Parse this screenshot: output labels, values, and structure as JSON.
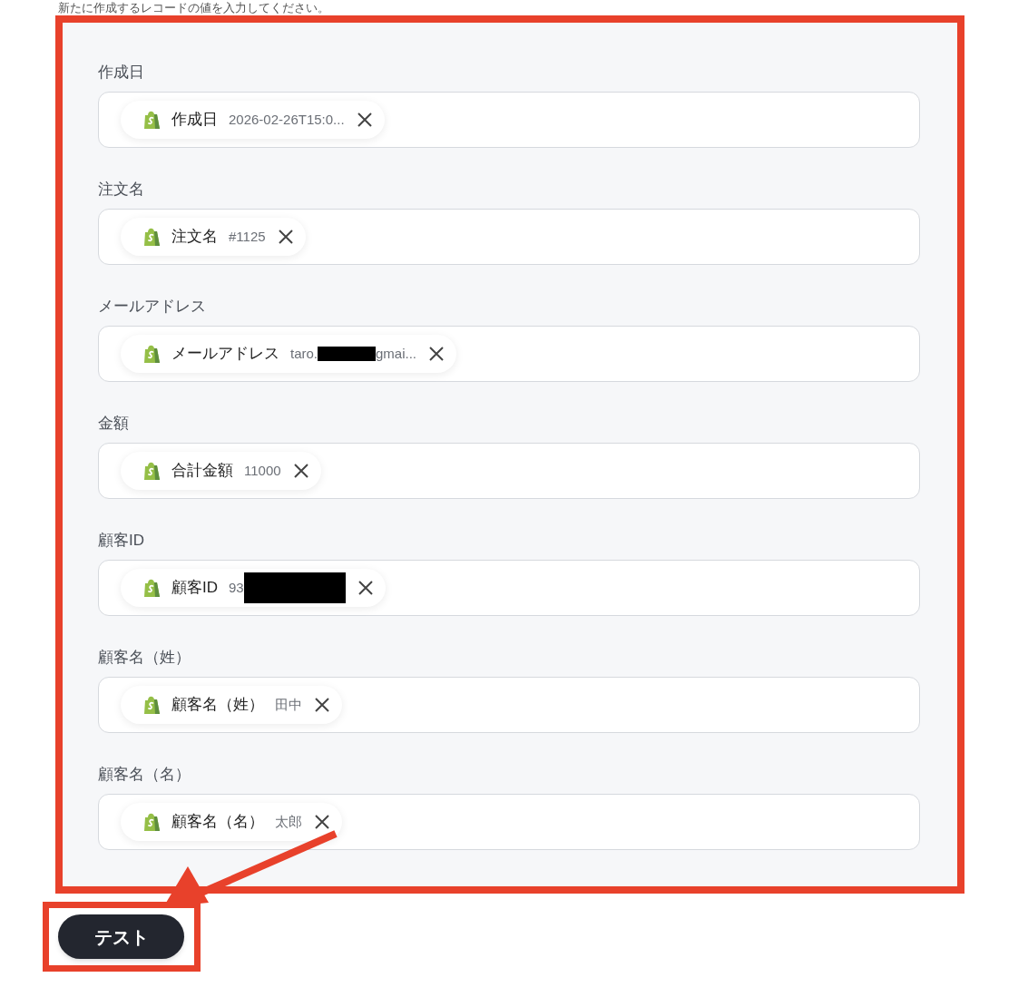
{
  "instruction": "新たに作成するレコードの値を入力してください。",
  "fields": [
    {
      "label": "作成日",
      "chip": {
        "name": "作成日",
        "value": "2026-02-26T15:0...",
        "redacted": false
      }
    },
    {
      "label": "注文名",
      "chip": {
        "name": "注文名",
        "value": "#1125",
        "redacted": false
      }
    },
    {
      "label": "メールアドレス",
      "chip": {
        "name": "メールアドレス",
        "value": "taro.",
        "redacted": true,
        "value_after": "gmai..."
      }
    },
    {
      "label": "金額",
      "chip": {
        "name": "合計金額",
        "value": "11000",
        "redacted": false
      }
    },
    {
      "label": "顧客ID",
      "chip": {
        "name": "顧客ID",
        "value": "93",
        "redacted": true
      }
    },
    {
      "label": "顧客名（姓）",
      "chip": {
        "name": "顧客名（姓）",
        "value": "田中",
        "redacted": false
      }
    },
    {
      "label": "顧客名（名）",
      "chip": {
        "name": "顧客名（名）",
        "value": "太郎",
        "redacted": false
      }
    }
  ],
  "test_button": "テスト"
}
